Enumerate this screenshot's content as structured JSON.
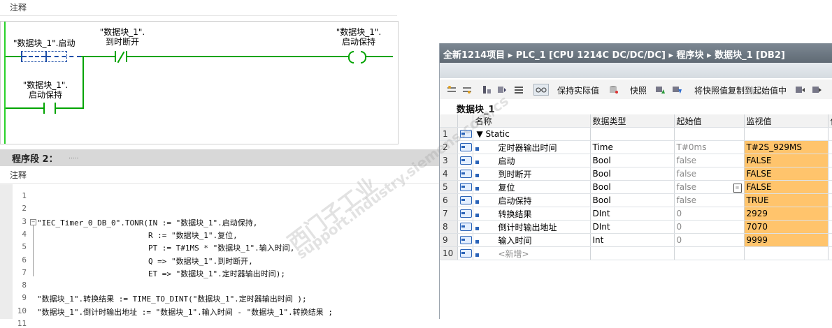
{
  "ladder": {
    "comment_label": "注释",
    "contact1_label": "\"数据块_1\".启动",
    "contact2_label_a": "\"数据块_1\".",
    "contact2_label_b": "到时断开",
    "coil_label_a": "\"数据块_1\".",
    "coil_label_b": "启动保持",
    "hold_label_a": "\"数据块_1\".",
    "hold_label_b": "启动保持",
    "colors": {
      "rail": "#2ad12a",
      "wire": "#00a400",
      "contact1": "#1f4fa8"
    }
  },
  "network2": {
    "title": "程序段 2：",
    "title_dots": ".....",
    "comment_label": "注释"
  },
  "code": {
    "lines": [
      {
        "n": "1",
        "text": ""
      },
      {
        "n": "2",
        "text": ""
      },
      {
        "n": "3",
        "text": "\"IEC_Timer_0_DB_0\".TONR(IN := \"数据块_1\".启动保持,"
      },
      {
        "n": "4",
        "text": "                        R := \"数据块_1\".复位,"
      },
      {
        "n": "5",
        "text": "                        PT := T#1MS * \"数据块_1\".输入时间,"
      },
      {
        "n": "6",
        "text": "                        Q => \"数据块_1\".到时断开,"
      },
      {
        "n": "7",
        "text": "                        ET => \"数据块_1\".定时器输出时间);"
      },
      {
        "n": "8",
        "text": ""
      },
      {
        "n": "9",
        "text": "\"数据块_1\".转换结果 := TIME_TO_DINT(\"数据块_1\".定时器输出时间 );"
      },
      {
        "n": "10",
        "text": "\"数据块_1\".倒计时输出地址 := \"数据块_1\".输入时间 - \"数据块_1\".转换结果 ;"
      },
      {
        "n": "11",
        "text": ""
      }
    ]
  },
  "db": {
    "breadcrumb": "全新1214项目 ▸ PLC_1 [CPU 1214C DC/DC/DC] ▸ 程序块 ▸ 数据块_1 [DB2]",
    "toolbar": {
      "keep_actual": "保持实际值",
      "snapshot": "快照",
      "copy_snapshot": "将快照值复制到起始值中"
    },
    "block_name": "数据块_1",
    "columns": [
      "",
      "",
      "名称",
      "数据类型",
      "起始值",
      "监视值",
      "保"
    ],
    "rows": [
      {
        "n": "1",
        "name": "▼ Static",
        "type": "",
        "start": "",
        "monitor": "",
        "indent": false
      },
      {
        "n": "2",
        "name": "定时器输出时间",
        "type": "Time",
        "start": "T#0ms",
        "monitor": "T#2S_929MS",
        "indent": true
      },
      {
        "n": "3",
        "name": "启动",
        "type": "Bool",
        "start": "false",
        "monitor": "FALSE",
        "indent": true
      },
      {
        "n": "4",
        "name": "到时断开",
        "type": "Bool",
        "start": "false",
        "monitor": "FALSE",
        "indent": true
      },
      {
        "n": "5",
        "name": "复位",
        "type": "Bool",
        "start": "false",
        "monitor": "FALSE",
        "indent": true
      },
      {
        "n": "6",
        "name": "启动保持",
        "type": "Bool",
        "start": "false",
        "monitor": "TRUE",
        "indent": true
      },
      {
        "n": "7",
        "name": "转换结果",
        "type": "DInt",
        "start": "0",
        "monitor": "2929",
        "indent": true
      },
      {
        "n": "8",
        "name": "倒计时输出地址",
        "type": "DInt",
        "start": "0",
        "monitor": "7070",
        "indent": true
      },
      {
        "n": "9",
        "name": "输入时间",
        "type": "Int",
        "start": "0",
        "monitor": "9999",
        "indent": true
      },
      {
        "n": "10",
        "name": "<新增>",
        "type": "",
        "start": "",
        "monitor": "",
        "indent": true
      }
    ],
    "colors": {
      "monitor_bg": "#ffc46c",
      "title_bg": "#6b7680",
      "tag_icon": "#2a63b8"
    }
  },
  "watermark": {
    "line1": "西门子工业",
    "line2": "support.industry.siemens.com/cs"
  }
}
